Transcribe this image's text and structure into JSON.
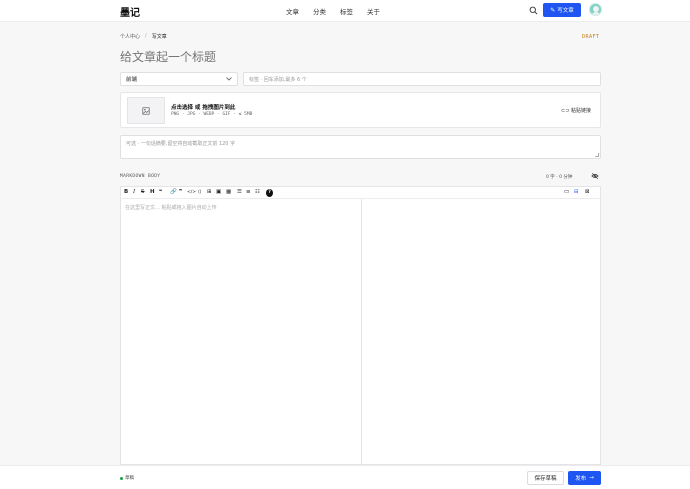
{
  "app": {
    "logo": "墨记"
  },
  "nav": {
    "items": [
      "文章",
      "分类",
      "标签",
      "关于"
    ]
  },
  "header": {
    "write_label": "写文章",
    "search_icon": "search-icon",
    "accent": "#1f55f0"
  },
  "breadcrumb": {
    "items": [
      "个人中心",
      "写文章"
    ],
    "separator": "/"
  },
  "status_tag": "DRAFT",
  "title_input": {
    "placeholder": "给文章起一个标题",
    "value": ""
  },
  "category_select": {
    "value": "前端"
  },
  "tags_input": {
    "placeholder": "标签 · 回车添加,最多 6 个"
  },
  "cover": {
    "title": "点击选择 或 拖拽图片到此",
    "subtitle": "PNG · JPG · WEBP · GIF · ≤ 5MB",
    "paste_link": "粘贴链接"
  },
  "summary": {
    "placeholder": "可选 · 一句话摘要,留空将自动截取正文前 120 字"
  },
  "markdown": {
    "label": "MARKDOWN BODY",
    "stats": "0 字 · 0 分钟",
    "placeholder": "在这里写正文… 粘贴或拖入图片自动上传"
  },
  "toolbar": {
    "left": [
      "B",
      "I",
      "S",
      "H",
      "❝",
      "🔗",
      "❞",
      "</>",
      "⟨⟩",
      "⊞",
      "▣",
      "▦",
      "☰",
      "≡",
      "☷",
      "?"
    ],
    "right": [
      "▭",
      "⊟",
      "⊠"
    ]
  },
  "footer": {
    "status": "草稿",
    "save_label": "保存草稿",
    "publish_label": "发布",
    "publish_arrow": "→"
  }
}
